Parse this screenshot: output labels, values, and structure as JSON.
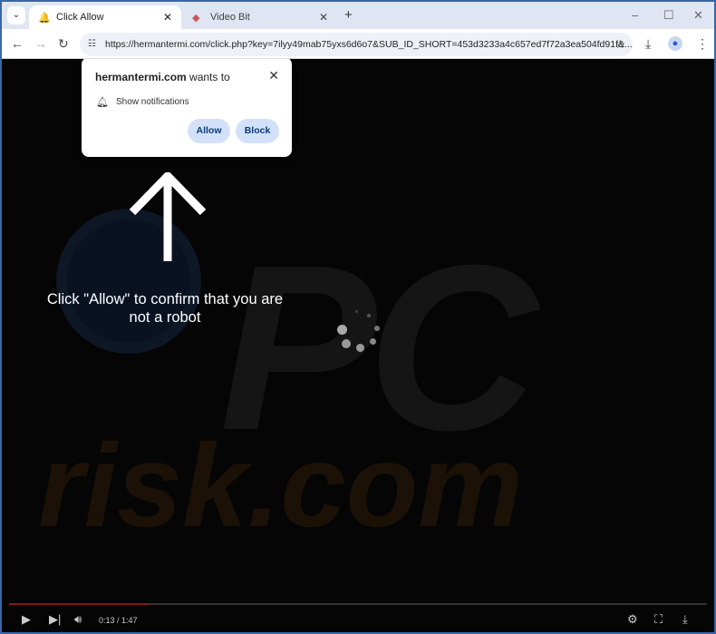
{
  "browser": {
    "tabs": [
      {
        "title": "Click Allow",
        "icon": "bell-icon",
        "active": true
      },
      {
        "title": "Video Bit",
        "icon": "video-icon",
        "active": false
      }
    ],
    "url": "https://hermantermi.com/click.php?key=7ilyy49mab75yxs6d6o7&SUB_ID_SHORT=453d3233a4c657ed7f72a3ea504fd91f&..."
  },
  "popup": {
    "site": "hermantermi.com",
    "wants_to": " wants to",
    "permission": "Show notifications",
    "allow": "Allow",
    "block": "Block"
  },
  "page": {
    "message": "Click \"Allow\" to confirm that you are not a robot",
    "watermark_top": "PC",
    "watermark_bottom": "risk.com"
  },
  "player": {
    "time": "0:13 / 1:47",
    "progress_fraction": 0.2,
    "progress_color": "#8a1515"
  }
}
